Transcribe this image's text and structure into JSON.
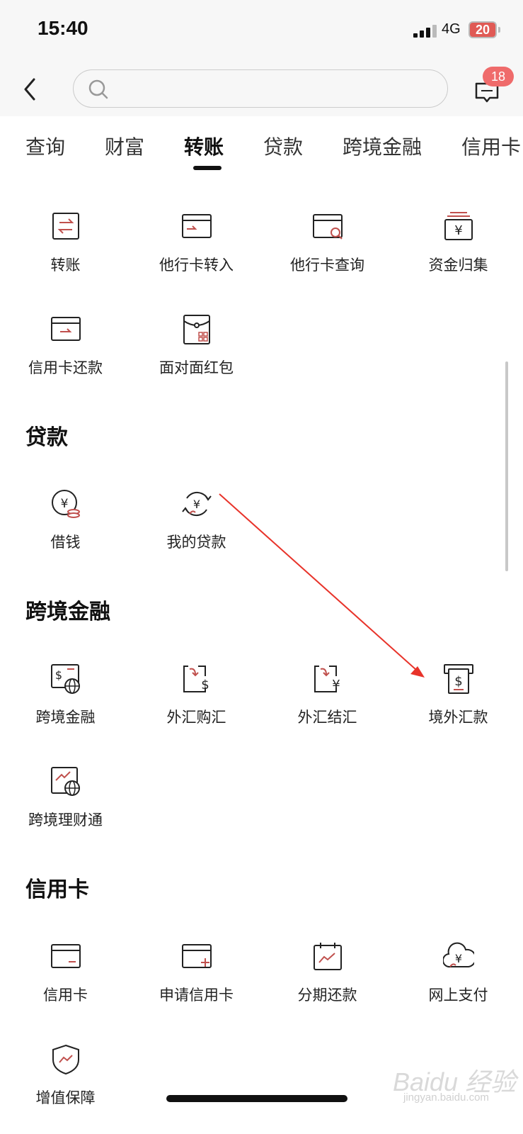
{
  "status": {
    "time": "15:40",
    "network": "4G",
    "battery": "20"
  },
  "search": {
    "placeholder": ""
  },
  "messages": {
    "badge": "18"
  },
  "tabs": [
    "查询",
    "财富",
    "转账",
    "贷款",
    "跨境金融",
    "信用卡"
  ],
  "active_tab": "转账",
  "transfer": {
    "items": [
      "转账",
      "他行卡转入",
      "他行卡查询",
      "资金归集",
      "信用卡还款",
      "面对面红包"
    ]
  },
  "loans": {
    "title": "贷款",
    "items": [
      "借钱",
      "我的贷款"
    ]
  },
  "cross_border": {
    "title": "跨境金融",
    "items": [
      "跨境金融",
      "外汇购汇",
      "外汇结汇",
      "境外汇款",
      "跨境理财通"
    ]
  },
  "credit_card": {
    "title": "信用卡",
    "items": [
      "信用卡",
      "申请信用卡",
      "分期还款",
      "网上支付",
      "增值保障"
    ]
  },
  "watermark": {
    "brand": "Baidu 经验",
    "url": "jingyan.baidu.com"
  },
  "colors": {
    "accent": "#c0504d",
    "annotation_arrow": "#e8332a",
    "badge": "#ef6b6b",
    "icon_stroke": "#222222"
  }
}
